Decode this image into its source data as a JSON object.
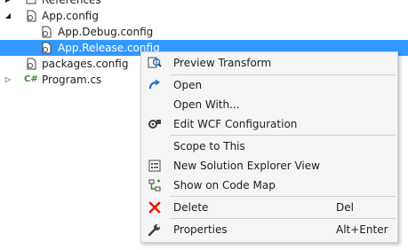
{
  "tree": {
    "items": [
      {
        "label": "References",
        "expander": "▶",
        "icon": "references-icon"
      },
      {
        "label": "App.config",
        "expander": "◢",
        "icon": "config-file-icon"
      },
      {
        "label": "App.Debug.config",
        "icon": "config-file-icon"
      },
      {
        "label": "App.Release.config",
        "icon": "config-file-icon",
        "selected": true
      },
      {
        "label": "packages.config",
        "icon": "config-file-icon"
      },
      {
        "label": "Program.cs",
        "expander": "▷",
        "icon": "csharp-file-icon",
        "icon_text": "C#"
      }
    ]
  },
  "context_menu": {
    "items": [
      {
        "label": "Preview Transform",
        "icon": "preview-transform-icon"
      },
      {
        "label": "Open",
        "icon": "open-arrow-icon"
      },
      {
        "label": "Open With...",
        "icon": ""
      },
      {
        "label": "Edit WCF Configuration",
        "icon": "wcf-config-icon"
      },
      {
        "label": "Scope to This",
        "icon": ""
      },
      {
        "label": "New Solution Explorer View",
        "icon": "solution-explorer-view-icon"
      },
      {
        "label": "Show on Code Map",
        "icon": "code-map-icon"
      },
      {
        "label": "Delete",
        "icon": "delete-x-icon",
        "shortcut": "Del"
      },
      {
        "label": "Properties",
        "icon": "wrench-icon",
        "shortcut": "Alt+Enter"
      }
    ]
  },
  "colors": {
    "selection": "#3399ff",
    "menu_background": "#f5f5f5",
    "menu_border": "#cccedb",
    "delete_red": "#e51400",
    "open_blue": "#1e73be",
    "csharp_green": "#388a34"
  }
}
